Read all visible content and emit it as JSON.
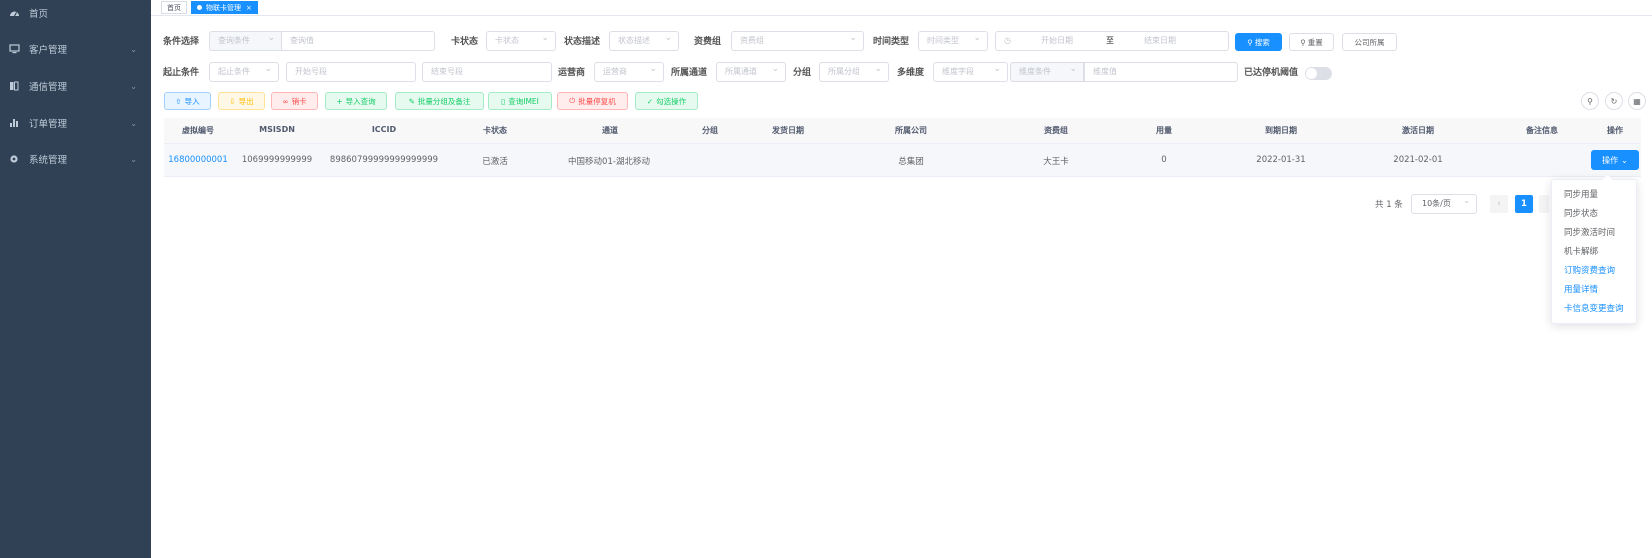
{
  "sidebar": {
    "items": [
      {
        "label": "首页",
        "icon": "dashboard-icon",
        "has_arrow": false
      },
      {
        "label": "客户管理",
        "icon": "monitor-icon",
        "has_arrow": true
      },
      {
        "label": "通信管理",
        "icon": "sim-card-icon",
        "has_arrow": true
      },
      {
        "label": "订单管理",
        "icon": "bar-chart-icon",
        "has_arrow": true
      },
      {
        "label": "系统管理",
        "icon": "gear-icon",
        "has_arrow": true
      }
    ]
  },
  "tabs": [
    {
      "label": "首页",
      "active": false
    },
    {
      "label": "物联卡管理",
      "active": true
    }
  ],
  "filters": {
    "condition_select": {
      "label": "条件选择",
      "select_placeholder": "查询条件",
      "input_placeholder": "查询值"
    },
    "card_status": {
      "label": "卡状态",
      "placeholder": "卡状态"
    },
    "status_desc": {
      "label": "状态描述",
      "placeholder": "状态描述"
    },
    "tariff_group": {
      "label": "资费组",
      "placeholder": "资费组"
    },
    "time_type": {
      "label": "时间类型",
      "placeholder": "时间类型"
    },
    "date_range": {
      "start": "开始日期",
      "sep": "至",
      "end": "结束日期"
    },
    "range_condition": {
      "label": "起止条件",
      "placeholder": "起止条件",
      "start_placeholder": "开始号段",
      "end_placeholder": "结束号段"
    },
    "operator": {
      "label": "运营商",
      "placeholder": "运营商"
    },
    "channel": {
      "label": "所属通道",
      "placeholder": "所属通道"
    },
    "group": {
      "label": "分组",
      "placeholder": "所属分组"
    },
    "multi_dim": {
      "label": "多维度",
      "placeholder": "维度字段",
      "cond_placeholder": "维度条件",
      "value_placeholder": "维度值"
    },
    "threshold": {
      "label": "已达停机阈值"
    }
  },
  "buttons": {
    "search": "搜索",
    "reset": "重置",
    "company": "公司所属",
    "import": "导入",
    "export": "导出",
    "cancel_card": "销卡",
    "import_query": "导入查询",
    "batch_group": "批量分组及备注",
    "query_imei": "查询IMEI",
    "batch_stop": "批量停复机",
    "checked_ops": "勾选操作"
  },
  "table": {
    "headers": [
      "虚拟编号",
      "MSISDN",
      "ICCID",
      "卡状态",
      "通道",
      "分组",
      "发货日期",
      "所属公司",
      "资费组",
      "用量",
      "到期日期",
      "激活日期",
      "备注信息",
      "操作"
    ],
    "rows": [
      {
        "vid": "16800000001",
        "msisdn": "1069999999999",
        "iccid": "89860799999999999999",
        "status": "已激活",
        "channel": "中国移动01-湖北移动",
        "group": "",
        "ship_date": "",
        "company": "总集团",
        "tariff": "大王卡",
        "usage": "0",
        "expire": "2022-01-31",
        "activate": "2021-02-01",
        "remark": "",
        "op_label": "操作"
      }
    ]
  },
  "pagination": {
    "total": "共 1 条",
    "page_size": "10条/页",
    "current": "1"
  },
  "dropdown": {
    "items": [
      {
        "label": "同步用量",
        "highlight": false
      },
      {
        "label": "同步状态",
        "highlight": false
      },
      {
        "label": "同步激活时间",
        "highlight": false
      },
      {
        "label": "机卡解绑",
        "highlight": false
      },
      {
        "label": "订购资费查询",
        "highlight": true
      },
      {
        "label": "用量详情",
        "highlight": true
      },
      {
        "label": "卡信息变更查询",
        "highlight": true
      }
    ]
  },
  "colors": {
    "primary": "#1890ff",
    "sidebar_bg": "#304156"
  }
}
